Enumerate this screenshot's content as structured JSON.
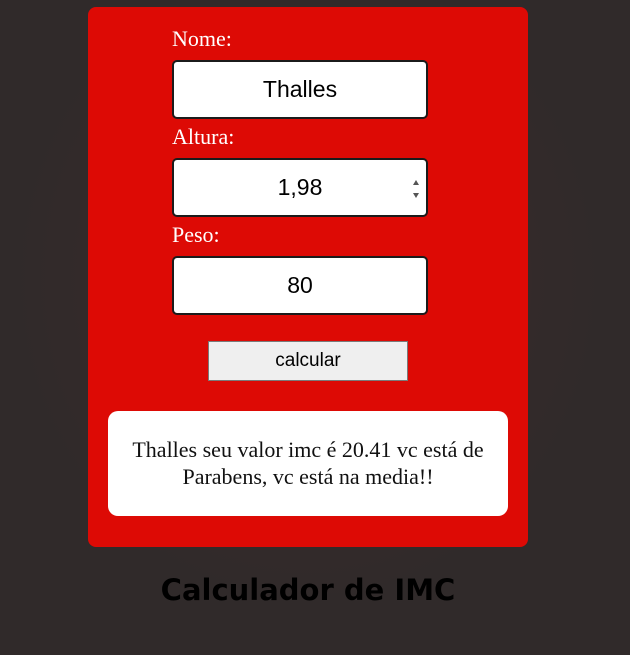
{
  "form": {
    "name_label": "Nome:",
    "name_value": "Thalles",
    "height_label": "Altura:",
    "height_value": "1,98",
    "weight_label": "Peso:",
    "weight_value": "80",
    "button_label": "calcular"
  },
  "result": {
    "message": "Thalles seu valor imc é 20.41 vc está de Parabens, vc está na media!!"
  },
  "page": {
    "title": "Calculador de IMC"
  },
  "colors": {
    "card_background": "#dd0a05",
    "page_background": "#302a2a",
    "label_text": "#ffffff"
  },
  "icons": {
    "height_spinner": "spinner-arrows-icon"
  }
}
